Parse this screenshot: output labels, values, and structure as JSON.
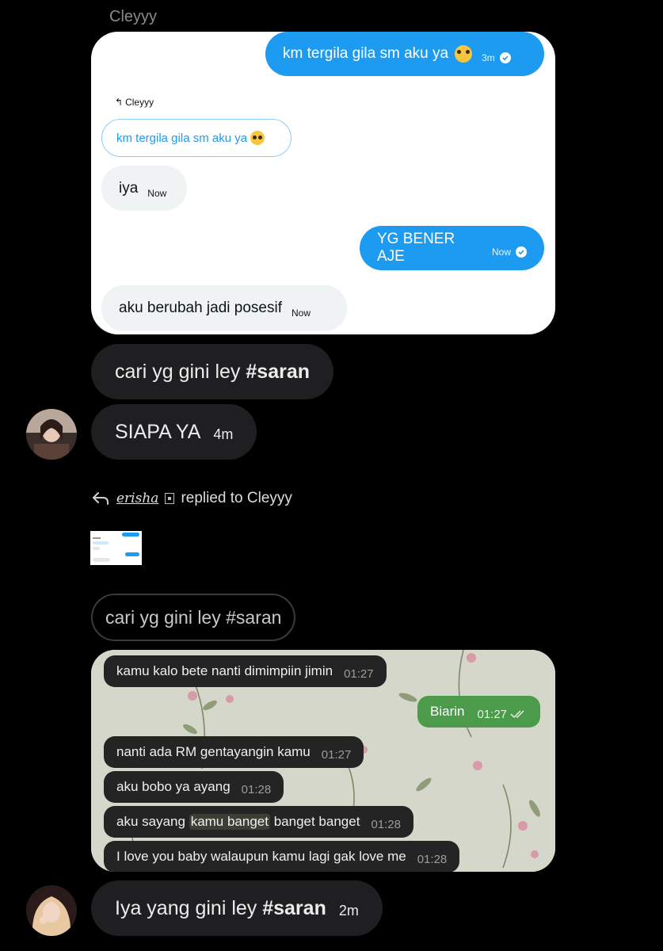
{
  "header": {
    "sender": "Cleyyy"
  },
  "twitter_card": {
    "out_1": {
      "text": "km tergila gila sm aku ya",
      "time": "3m"
    },
    "reply_to": "Cleyyy",
    "quoted": "km tergila gila sm aku ya",
    "in_1": {
      "text": "iya",
      "time": "Now"
    },
    "out_2": {
      "text": "YG BENER AJE",
      "time": "Now"
    },
    "in_2": {
      "text": "aku berubah jadi posesif",
      "time": "Now"
    },
    "colors": {
      "out_bubble": "#1d9bf0",
      "in_bubble": "#eff3f4"
    }
  },
  "message_1": {
    "text": "cari yg gini ley ",
    "tag": "#saran"
  },
  "message_2": {
    "text": "SIAPA YA",
    "time": "4m"
  },
  "reply_notice": {
    "user": "erisha",
    "text": "replied to Cleyyy"
  },
  "quoted_reply": {
    "text": "cari yg gini ley #saran"
  },
  "whatsapp_card": {
    "m1": {
      "text": "kamu kalo bete nanti dimimpiin jimin",
      "time": "01:27"
    },
    "m2": {
      "text": "Biarin",
      "time": "01:27"
    },
    "m3": {
      "text": "nanti ada RM gentayangin kamu",
      "time": "01:27"
    },
    "m4": {
      "text": "aku bobo ya ayang",
      "time": "01:28"
    },
    "m5": {
      "pre": "aku sayang ",
      "highlight": "kamu banget",
      "post": " banget banget",
      "time": "01:28"
    },
    "m6": {
      "text": "I love you baby walaupun kamu lagi gak love me",
      "time": "01:28"
    },
    "colors": {
      "out_bubble": "#4b9b4a",
      "in_bubble": "#242424"
    }
  },
  "message_3": {
    "text": "Iya yang gini ley ",
    "tag": "#saran",
    "time": "2m"
  }
}
